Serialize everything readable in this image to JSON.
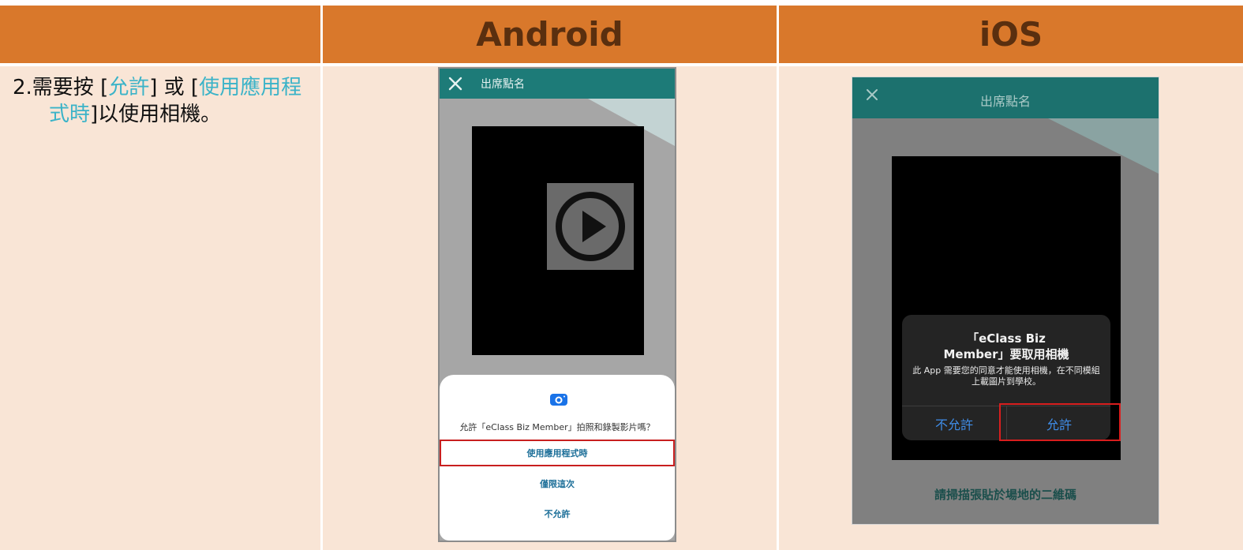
{
  "header": {
    "android": "Android",
    "ios": "iOS"
  },
  "instruction": {
    "prefix": "2.需要按 [",
    "allow": "允許",
    "middle": "] 或 [",
    "while_using": "使用應用程式時",
    "suffix": "]以使用相機。"
  },
  "android": {
    "title": "出席點名",
    "question": "允許「eClass Biz Member」拍照和錄製影片嗎？",
    "options": [
      "使用應用程式時",
      "僅限這次",
      "不允許"
    ]
  },
  "ios": {
    "title": "出席點名",
    "alert_title_line1": "「eClass Biz",
    "alert_title_line2": "Member」要取用相機",
    "alert_message": "此 App 需要您的同意才能使用相機，在不同模組上載圖片到學校。",
    "deny": "不允許",
    "allow": "允許",
    "scan_hint": "請掃描張貼於場地的二維碼"
  },
  "colors": {
    "header_bg": "#d9782b",
    "header_text": "#5a2f0f",
    "cell_bg": "#f9e5d6",
    "highlight_text": "#3bb3c8",
    "selection_border": "#c81f1f",
    "app_bar": "#1d7b78",
    "ios_button": "#3f8de8"
  },
  "icons": [
    "close-icon",
    "play-icon",
    "camera-icon"
  ]
}
